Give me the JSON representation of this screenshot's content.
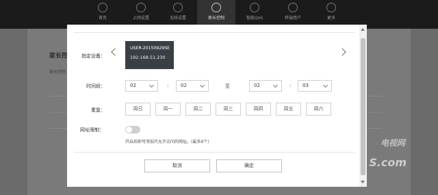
{
  "nav": {
    "items": [
      {
        "label": "首页"
      },
      {
        "label": "上网设置"
      },
      {
        "label": "无线设置"
      },
      {
        "label": "家长控制"
      },
      {
        "label": "智能QoS"
      },
      {
        "label": "终端用户"
      },
      {
        "label": "更多"
      }
    ],
    "active_index": 3
  },
  "background_page": {
    "title": "家长控",
    "subtitle": "家长控制"
  },
  "watermark": {
    "line1": "电视网",
    "line2": "S.com"
  },
  "modal": {
    "device": {
      "label": "指定设备：",
      "name": "USER-20150929SE",
      "ip": "192.168.51.230"
    },
    "time": {
      "label": "时间段：",
      "start_hour": "02",
      "start_minute": "02",
      "to_text": "至",
      "end_hour": "02",
      "end_minute": "03",
      "colon": ":"
    },
    "repeat": {
      "label": "重复：",
      "days": [
        "周日",
        "周一",
        "周二",
        "周三",
        "周四",
        "周五",
        "周六"
      ]
    },
    "url_limit": {
      "label": "网址限制：",
      "enabled": false,
      "hint": "开启后即可添加只允许访问的网址。(最多8个)"
    },
    "buttons": {
      "cancel": "取消",
      "confirm": "确定"
    }
  }
}
